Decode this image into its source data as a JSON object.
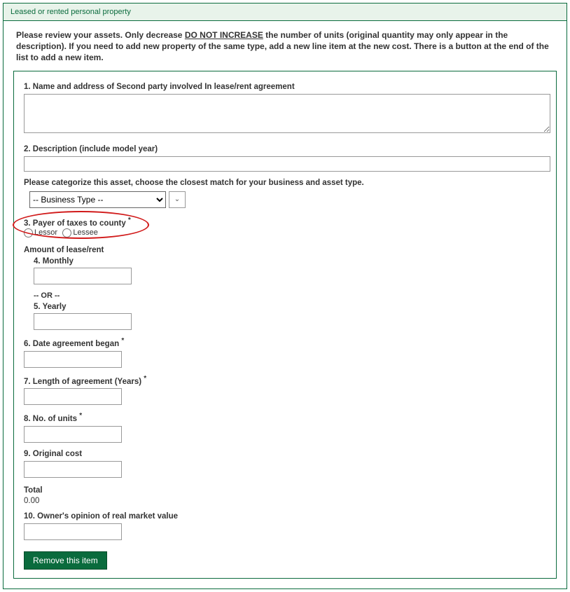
{
  "header": {
    "title": "Leased or rented personal property"
  },
  "instructions": {
    "lead": "Please review your assets. Only decrease ",
    "emph": "DO NOT INCREASE",
    "rest": " the number of units (original quantity may only appear in the description). If you need to add new property of the same type, add a new line item at the new cost. There is a button at the end of the list to add a new item."
  },
  "fields": {
    "f1_label": "1. Name and address of Second party involved In lease/rent agreement",
    "f2_label": "2. Description (include model year)",
    "cat_helper": "Please categorize this asset, choose the closest match for your business and asset type.",
    "bt_placeholder": "-- Business Type --",
    "f3_label": "3. Payer of taxes to county ",
    "lessor": "Lessor",
    "lessee": "Lessee",
    "amount_title": "Amount of lease/rent",
    "f4_label": "4. Monthly",
    "or_sep": "-- OR --",
    "f5_label": "5. Yearly",
    "f6_label": "6. Date agreement began ",
    "f7_label": "7. Length of agreement (Years) ",
    "f8_label": "8. No. of units ",
    "f9_label": "9. Original cost",
    "total_label": "Total",
    "total_value": "0.00",
    "f10_label": "10. Owner's opinion of real market value",
    "remove_btn": "Remove this item"
  }
}
